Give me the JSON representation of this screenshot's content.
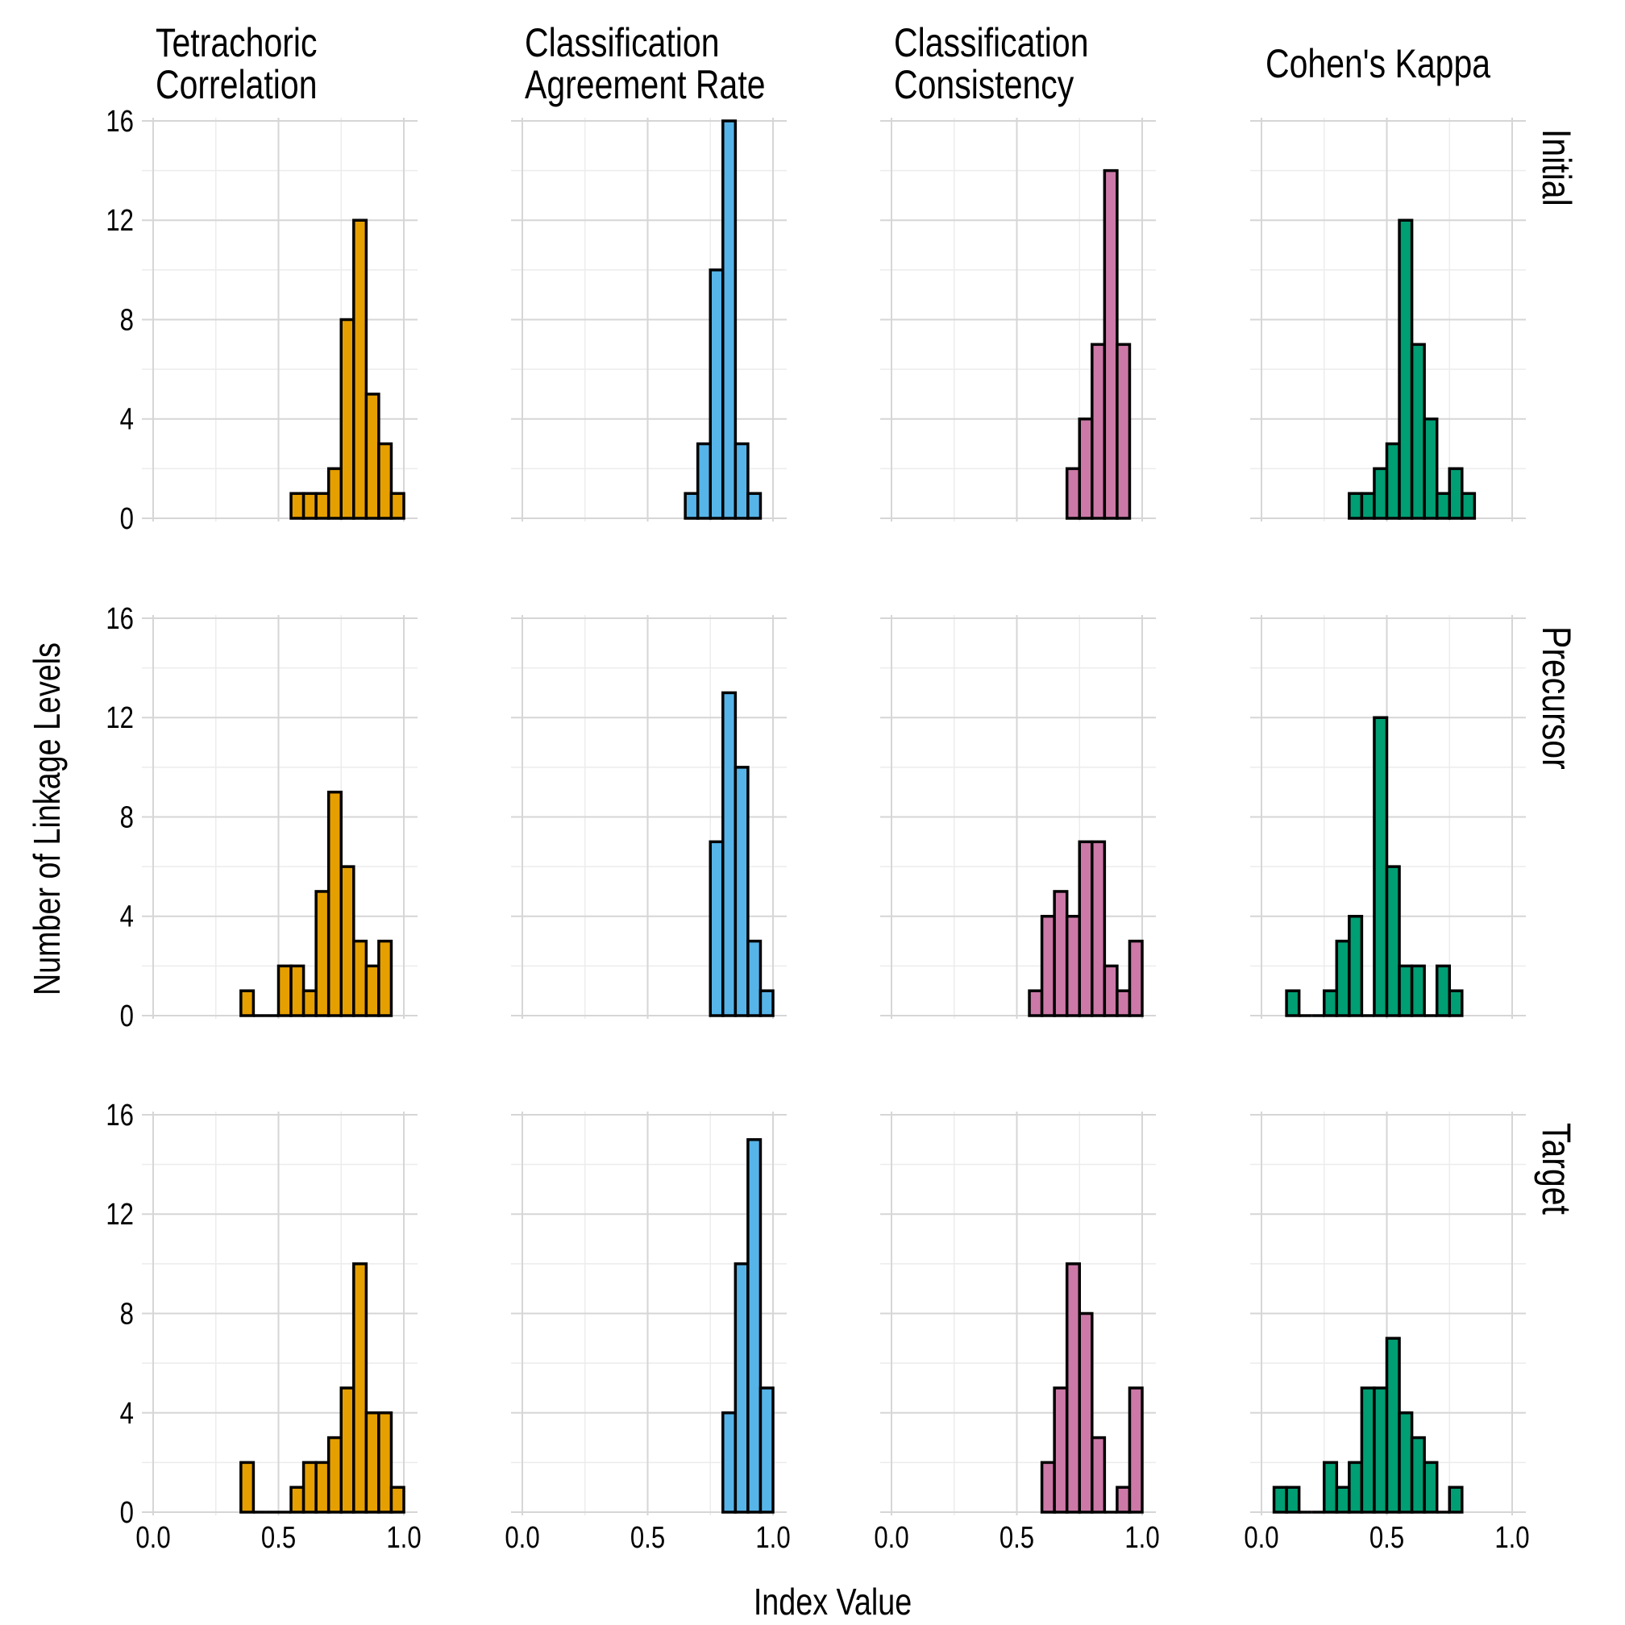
{
  "chart_data": {
    "type": "bar",
    "subtype": "histogram-facet-grid",
    "bin_width": 0.05,
    "xlabel": "Index Value",
    "ylabel": "Number of Linkage Levels",
    "xlim": [
      0,
      1
    ],
    "ylim": [
      0,
      16
    ],
    "x_ticks": [
      "0.0",
      "0.5",
      "1.0"
    ],
    "x_tick_values": [
      0.0,
      0.5,
      1.0
    ],
    "y_ticks": [
      "0",
      "4",
      "8",
      "12",
      "16"
    ],
    "y_tick_values": [
      0,
      4,
      8,
      12,
      16
    ],
    "grid": true,
    "columns": [
      {
        "key": "tetrachoric",
        "title_lines": [
          "Tetrachoric",
          "Correlation"
        ],
        "color": "#E69F00"
      },
      {
        "key": "car",
        "title_lines": [
          "Classification",
          "Agreement Rate"
        ],
        "color": "#56B4E9"
      },
      {
        "key": "cc",
        "title_lines": [
          "Classification",
          "Consistency"
        ],
        "color": "#CC79A7"
      },
      {
        "key": "kappa",
        "title_lines": [
          "Cohen's Kappa"
        ],
        "color": "#009E73"
      }
    ],
    "rows": [
      {
        "key": "initial",
        "label": "Initial"
      },
      {
        "key": "precursor",
        "label": "Precursor"
      },
      {
        "key": "target",
        "label": "Target"
      }
    ],
    "panels": {
      "initial": {
        "tetrachoric": {
          "bin_start": 0.55,
          "counts": [
            1,
            1,
            1,
            2,
            8,
            12,
            5,
            3,
            1
          ]
        },
        "car": {
          "bin_start": 0.65,
          "counts": [
            1,
            3,
            10,
            16,
            3,
            1
          ]
        },
        "cc": {
          "bin_start": 0.7,
          "counts": [
            2,
            4,
            7,
            14,
            7
          ]
        },
        "kappa": {
          "bin_start": 0.35,
          "counts": [
            1,
            1,
            2,
            3,
            12,
            7,
            4,
            1,
            2,
            1
          ]
        }
      },
      "precursor": {
        "tetrachoric": {
          "bin_start": 0.35,
          "counts": [
            1,
            0,
            0,
            2,
            2,
            1,
            5,
            9,
            6,
            3,
            2,
            3
          ]
        },
        "car": {
          "bin_start": 0.75,
          "counts": [
            7,
            13,
            10,
            3,
            1
          ]
        },
        "cc": {
          "bin_start": 0.55,
          "counts": [
            1,
            4,
            5,
            4,
            7,
            7,
            2,
            1,
            3
          ]
        },
        "kappa": {
          "bin_start": 0.1,
          "counts": [
            1,
            0,
            0,
            1,
            3,
            4,
            0,
            12,
            6,
            2,
            2,
            0,
            2,
            1
          ]
        }
      },
      "target": {
        "tetrachoric": {
          "bin_start": 0.35,
          "counts": [
            2,
            0,
            0,
            0,
            1,
            2,
            2,
            3,
            5,
            10,
            4,
            4,
            1
          ]
        },
        "car": {
          "bin_start": 0.8,
          "counts": [
            4,
            10,
            15,
            5
          ]
        },
        "cc": {
          "bin_start": 0.6,
          "counts": [
            2,
            5,
            10,
            8,
            3,
            0,
            1,
            5
          ]
        },
        "kappa": {
          "bin_start": 0.05,
          "counts": [
            1,
            1,
            0,
            0,
            2,
            1,
            2,
            5,
            5,
            7,
            4,
            3,
            2,
            0,
            1
          ]
        }
      }
    }
  }
}
